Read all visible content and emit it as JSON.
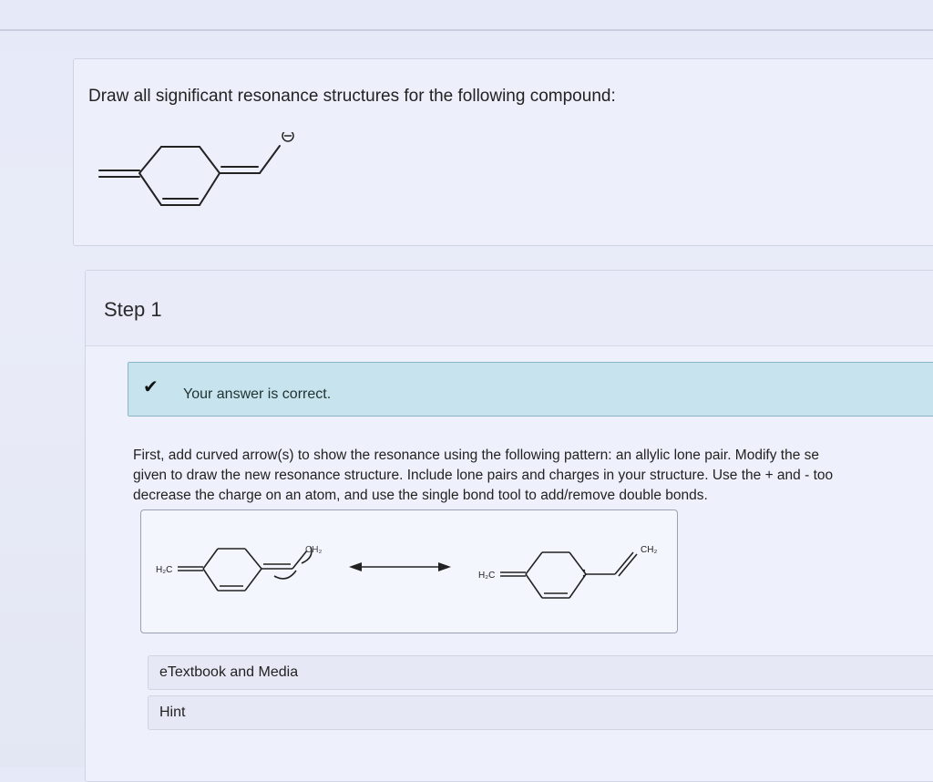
{
  "question": {
    "prompt": "Draw all significant resonance structures for the following compound:"
  },
  "step": {
    "title": "Step 1",
    "status_icon": "check-icon",
    "status_text": "Your answer is correct.",
    "instructions": [
      "First, add curved arrow(s) to show the resonance using the following pattern: an allylic lone pair. Modify the se",
      "given to draw the new resonance structure. Include lone pairs and charges in your structure. Use the + and - too",
      "decrease the charge on an atom, and use the single bond tool to add/remove double bonds."
    ],
    "answer": {
      "left_label": "H₂C",
      "left_anion": "CH₂",
      "right_label": "H₂C",
      "right_terminal": "CH₂"
    }
  },
  "resources": {
    "etextbook_label": "eTextbook and Media",
    "hint_label": "Hint"
  },
  "colors": {
    "correct_banner": "#c6e3ee",
    "correct_border": "#8ab5c7"
  }
}
